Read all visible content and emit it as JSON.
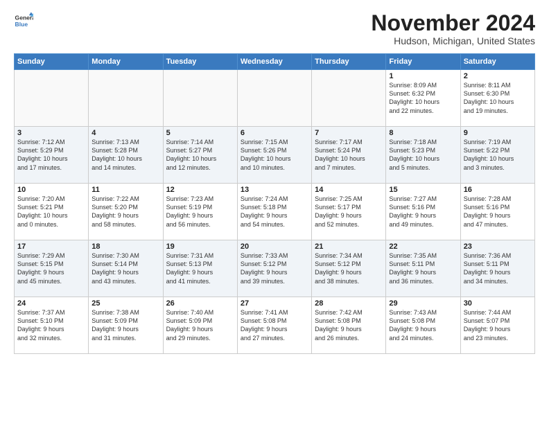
{
  "logo": {
    "line1": "General",
    "line2": "Blue"
  },
  "header": {
    "month": "November 2024",
    "location": "Hudson, Michigan, United States"
  },
  "weekdays": [
    "Sunday",
    "Monday",
    "Tuesday",
    "Wednesday",
    "Thursday",
    "Friday",
    "Saturday"
  ],
  "weeks": [
    [
      {
        "day": "",
        "info": ""
      },
      {
        "day": "",
        "info": ""
      },
      {
        "day": "",
        "info": ""
      },
      {
        "day": "",
        "info": ""
      },
      {
        "day": "",
        "info": ""
      },
      {
        "day": "1",
        "info": "Sunrise: 8:09 AM\nSunset: 6:32 PM\nDaylight: 10 hours\nand 22 minutes."
      },
      {
        "day": "2",
        "info": "Sunrise: 8:11 AM\nSunset: 6:30 PM\nDaylight: 10 hours\nand 19 minutes."
      }
    ],
    [
      {
        "day": "3",
        "info": "Sunrise: 7:12 AM\nSunset: 5:29 PM\nDaylight: 10 hours\nand 17 minutes."
      },
      {
        "day": "4",
        "info": "Sunrise: 7:13 AM\nSunset: 5:28 PM\nDaylight: 10 hours\nand 14 minutes."
      },
      {
        "day": "5",
        "info": "Sunrise: 7:14 AM\nSunset: 5:27 PM\nDaylight: 10 hours\nand 12 minutes."
      },
      {
        "day": "6",
        "info": "Sunrise: 7:15 AM\nSunset: 5:26 PM\nDaylight: 10 hours\nand 10 minutes."
      },
      {
        "day": "7",
        "info": "Sunrise: 7:17 AM\nSunset: 5:24 PM\nDaylight: 10 hours\nand 7 minutes."
      },
      {
        "day": "8",
        "info": "Sunrise: 7:18 AM\nSunset: 5:23 PM\nDaylight: 10 hours\nand 5 minutes."
      },
      {
        "day": "9",
        "info": "Sunrise: 7:19 AM\nSunset: 5:22 PM\nDaylight: 10 hours\nand 3 minutes."
      }
    ],
    [
      {
        "day": "10",
        "info": "Sunrise: 7:20 AM\nSunset: 5:21 PM\nDaylight: 10 hours\nand 0 minutes."
      },
      {
        "day": "11",
        "info": "Sunrise: 7:22 AM\nSunset: 5:20 PM\nDaylight: 9 hours\nand 58 minutes."
      },
      {
        "day": "12",
        "info": "Sunrise: 7:23 AM\nSunset: 5:19 PM\nDaylight: 9 hours\nand 56 minutes."
      },
      {
        "day": "13",
        "info": "Sunrise: 7:24 AM\nSunset: 5:18 PM\nDaylight: 9 hours\nand 54 minutes."
      },
      {
        "day": "14",
        "info": "Sunrise: 7:25 AM\nSunset: 5:17 PM\nDaylight: 9 hours\nand 52 minutes."
      },
      {
        "day": "15",
        "info": "Sunrise: 7:27 AM\nSunset: 5:16 PM\nDaylight: 9 hours\nand 49 minutes."
      },
      {
        "day": "16",
        "info": "Sunrise: 7:28 AM\nSunset: 5:16 PM\nDaylight: 9 hours\nand 47 minutes."
      }
    ],
    [
      {
        "day": "17",
        "info": "Sunrise: 7:29 AM\nSunset: 5:15 PM\nDaylight: 9 hours\nand 45 minutes."
      },
      {
        "day": "18",
        "info": "Sunrise: 7:30 AM\nSunset: 5:14 PM\nDaylight: 9 hours\nand 43 minutes."
      },
      {
        "day": "19",
        "info": "Sunrise: 7:31 AM\nSunset: 5:13 PM\nDaylight: 9 hours\nand 41 minutes."
      },
      {
        "day": "20",
        "info": "Sunrise: 7:33 AM\nSunset: 5:12 PM\nDaylight: 9 hours\nand 39 minutes."
      },
      {
        "day": "21",
        "info": "Sunrise: 7:34 AM\nSunset: 5:12 PM\nDaylight: 9 hours\nand 38 minutes."
      },
      {
        "day": "22",
        "info": "Sunrise: 7:35 AM\nSunset: 5:11 PM\nDaylight: 9 hours\nand 36 minutes."
      },
      {
        "day": "23",
        "info": "Sunrise: 7:36 AM\nSunset: 5:11 PM\nDaylight: 9 hours\nand 34 minutes."
      }
    ],
    [
      {
        "day": "24",
        "info": "Sunrise: 7:37 AM\nSunset: 5:10 PM\nDaylight: 9 hours\nand 32 minutes."
      },
      {
        "day": "25",
        "info": "Sunrise: 7:38 AM\nSunset: 5:09 PM\nDaylight: 9 hours\nand 31 minutes."
      },
      {
        "day": "26",
        "info": "Sunrise: 7:40 AM\nSunset: 5:09 PM\nDaylight: 9 hours\nand 29 minutes."
      },
      {
        "day": "27",
        "info": "Sunrise: 7:41 AM\nSunset: 5:08 PM\nDaylight: 9 hours\nand 27 minutes."
      },
      {
        "day": "28",
        "info": "Sunrise: 7:42 AM\nSunset: 5:08 PM\nDaylight: 9 hours\nand 26 minutes."
      },
      {
        "day": "29",
        "info": "Sunrise: 7:43 AM\nSunset: 5:08 PM\nDaylight: 9 hours\nand 24 minutes."
      },
      {
        "day": "30",
        "info": "Sunrise: 7:44 AM\nSunset: 5:07 PM\nDaylight: 9 hours\nand 23 minutes."
      }
    ]
  ]
}
